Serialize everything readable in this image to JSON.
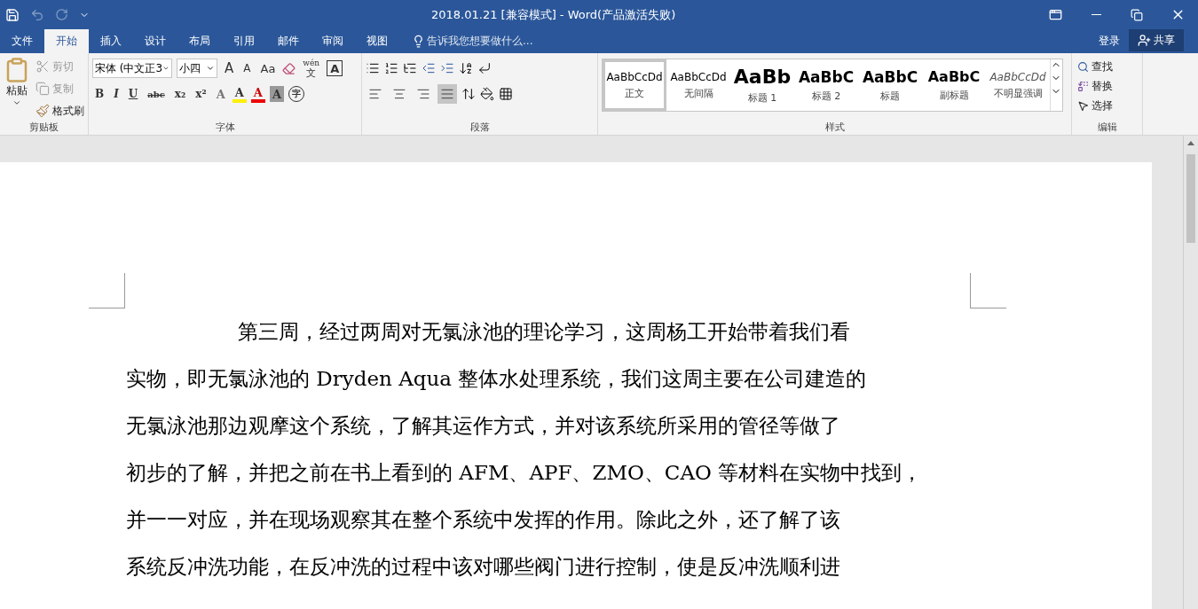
{
  "window": {
    "title": "2018.01.21 [兼容模式] - Word(产品激活失败)"
  },
  "tabs": [
    {
      "label": "文件",
      "selected": false
    },
    {
      "label": "开始",
      "selected": true
    },
    {
      "label": "插入",
      "selected": false
    },
    {
      "label": "设计",
      "selected": false
    },
    {
      "label": "布局",
      "selected": false
    },
    {
      "label": "引用",
      "selected": false
    },
    {
      "label": "邮件",
      "selected": false
    },
    {
      "label": "审阅",
      "selected": false
    },
    {
      "label": "视图",
      "selected": false
    }
  ],
  "tell_me": {
    "placeholder": "告诉我您想要做什么..."
  },
  "account": {
    "login": "登录",
    "share": "共享"
  },
  "clipboard": {
    "paste": "粘贴",
    "items": [
      {
        "label": "剪切",
        "disabled": true
      },
      {
        "label": "复制",
        "disabled": true
      },
      {
        "label": "格式刷",
        "disabled": false
      }
    ],
    "label": "剪贴板"
  },
  "font": {
    "name": "宋体 (中文正3",
    "size": "小四",
    "row1": [
      "A",
      "A",
      "Aa"
    ],
    "row2": [
      "B",
      "I",
      "U",
      "abc",
      "x₂",
      "x²"
    ],
    "letters": [
      "A",
      "A",
      "A",
      "A",
      "A"
    ],
    "phonetic": "wén",
    "phonetic_char": "文",
    "enclose": "字",
    "label": "字体"
  },
  "paragraph": {
    "align": [
      {
        "selected": false
      },
      {
        "selected": false
      },
      {
        "selected": false
      },
      {
        "selected": true
      }
    ],
    "label": "段落"
  },
  "styles": {
    "items": [
      {
        "preview": "AaBbCcDd",
        "name": "正文",
        "kind": "body",
        "selected": true
      },
      {
        "preview": "AaBbCcDd",
        "name": "无间隔",
        "kind": "body",
        "selected": false
      },
      {
        "preview": "AaBb",
        "name": "标题 1",
        "kind": "heading1",
        "selected": false
      },
      {
        "preview": "AaBbC",
        "name": "标题 2",
        "kind": "heading2",
        "selected": false
      },
      {
        "preview": "AaBbC",
        "name": "标题",
        "kind": "title",
        "selected": false
      },
      {
        "preview": "AaBbC",
        "name": "副标题",
        "kind": "subtitle",
        "selected": false
      },
      {
        "preview": "AaBbCcDd",
        "name": "不明显强调",
        "kind": "emphasis",
        "selected": false
      }
    ],
    "label": "样式"
  },
  "editing": {
    "items": [
      "查找",
      "替换",
      "选择"
    ],
    "label": "编辑"
  },
  "document": {
    "lines": [
      "第三周，经过两周对无氯泳池的理论学习，这周杨工开始带着我们看",
      "实物，即无氯泳池的 Dryden Aqua 整体水处理系统，我们这周主要在公司建造的",
      "无氯泳池那边观摩这个系统，了解其运作方式，并对该系统所采用的管径等做了",
      "初步的了解，并把之前在书上看到的 AFM、APF、ZMO、CAO 等材料在实物中找到，",
      "并一一对应，并在现场观察其在整个系统中发挥的作用。除此之外，还了解了该",
      "系统反冲洗功能，在反冲洗的过程中该对哪些阀门进行控制，使是反冲洗顺利进"
    ]
  }
}
